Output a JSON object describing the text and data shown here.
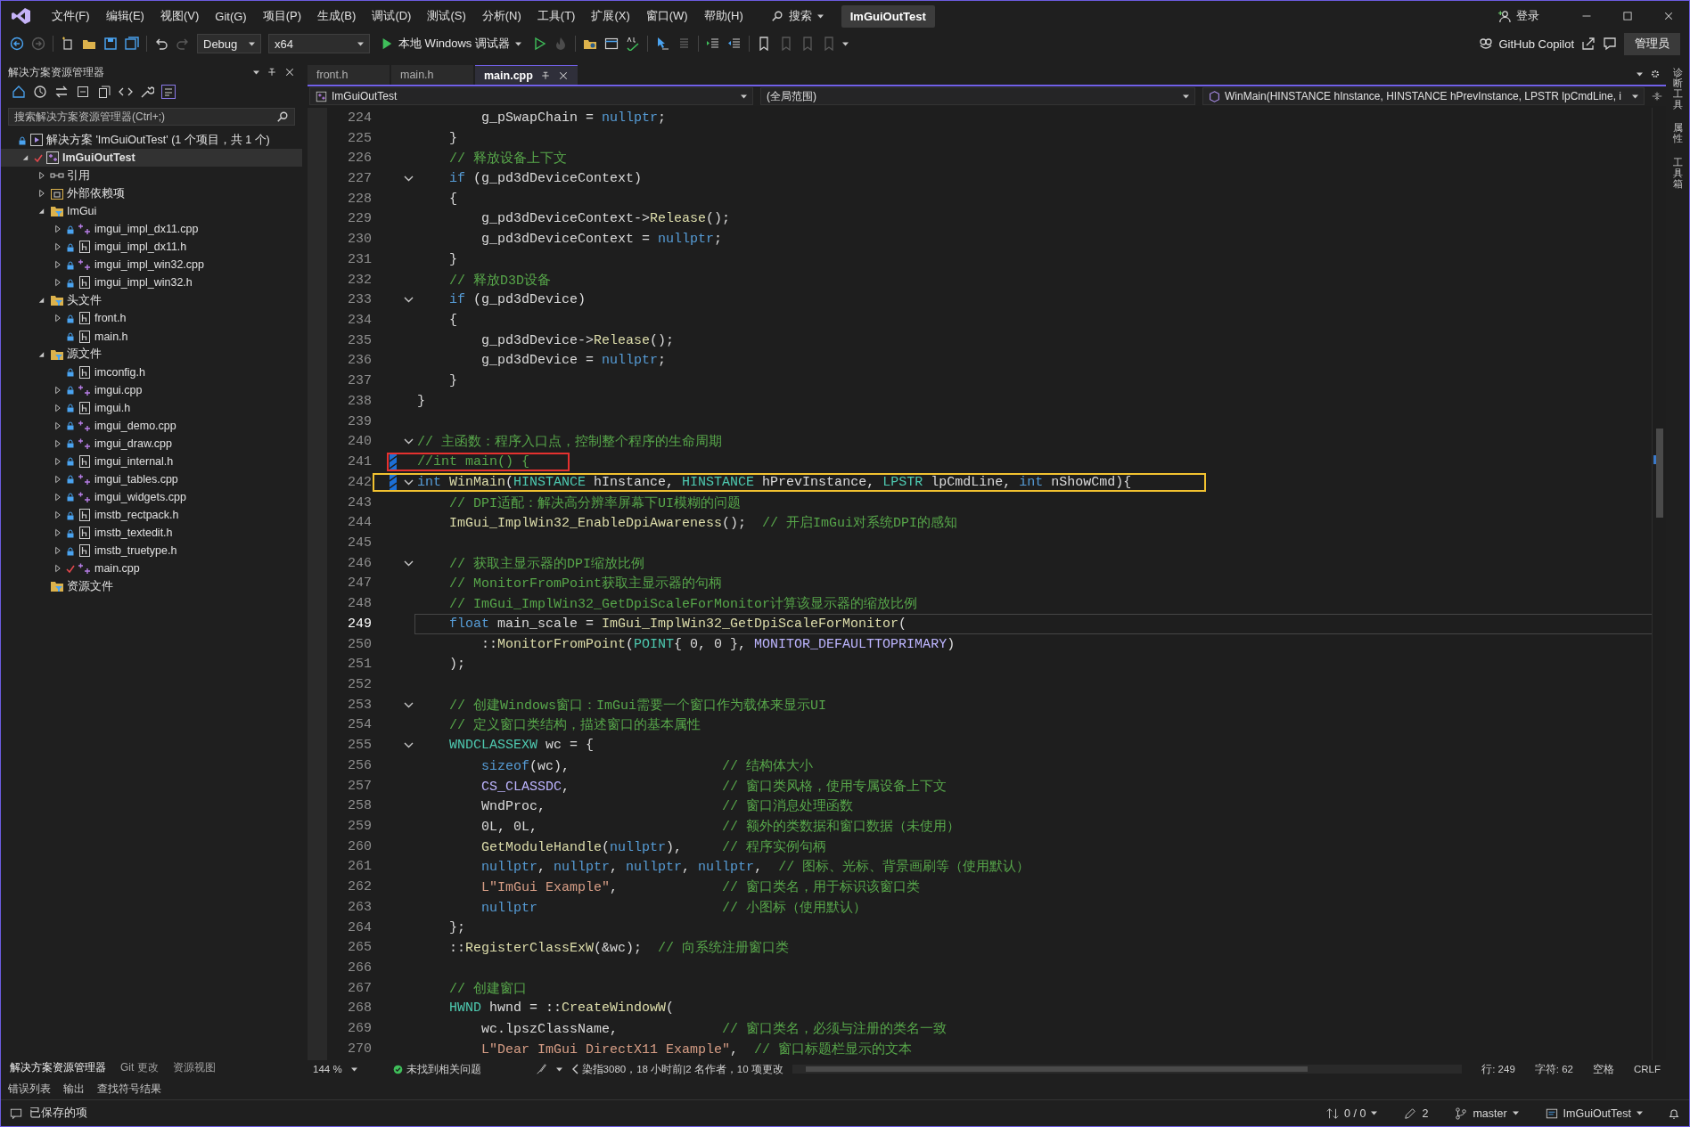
{
  "title_bar": {
    "menu": [
      "文件(F)",
      "编辑(E)",
      "视图(V)",
      "Git(G)",
      "项目(P)",
      "生成(B)",
      "调试(D)",
      "测试(S)",
      "分析(N)",
      "工具(T)",
      "扩展(X)",
      "窗口(W)",
      "帮助(H)"
    ],
    "search_label": "搜索",
    "solution_name": "ImGuiOutTest",
    "login_label": "登录"
  },
  "toolbar": {
    "configuration": "Debug",
    "platform": "x64",
    "run_label": "本地 Windows 调试器",
    "copilot_label": "GitHub Copilot",
    "admin_label": "管理员"
  },
  "solution_explorer": {
    "title": "解决方案资源管理器",
    "search": {
      "placeholder": "搜索解决方案资源管理器(Ctrl+;)"
    },
    "tree": [
      {
        "label": "解决方案 'ImGuiOutTest' (1 个项目，共 1 个)",
        "kind": "solution",
        "expandable": false,
        "locked": true,
        "edited": false,
        "selected": false,
        "children": [
          {
            "label": "ImGuiOutTest",
            "kind": "project",
            "expandable": true,
            "expanded": true,
            "locked": false,
            "edited": true,
            "selected": true,
            "children": [
              {
                "label": "引用",
                "kind": "references",
                "expandable": true,
                "expanded": false,
                "locked": false,
                "edited": false,
                "selected": false
              },
              {
                "label": "外部依赖项",
                "kind": "external",
                "expandable": true,
                "expanded": false,
                "locked": false,
                "edited": false,
                "selected": false
              },
              {
                "label": "ImGui",
                "kind": "filter",
                "expandable": true,
                "expanded": true,
                "locked": false,
                "edited": false,
                "selected": false,
                "children": [
                  {
                    "label": "imgui_impl_dx11.cpp",
                    "kind": "cpp",
                    "expandable": true,
                    "expanded": false,
                    "locked": true,
                    "edited": false,
                    "selected": false
                  },
                  {
                    "label": "imgui_impl_dx11.h",
                    "kind": "header",
                    "expandable": true,
                    "expanded": false,
                    "locked": true,
                    "edited": false,
                    "selected": false
                  },
                  {
                    "label": "imgui_impl_win32.cpp",
                    "kind": "cpp",
                    "expandable": true,
                    "expanded": false,
                    "locked": true,
                    "edited": false,
                    "selected": false
                  },
                  {
                    "label": "imgui_impl_win32.h",
                    "kind": "header",
                    "expandable": true,
                    "expanded": false,
                    "locked": true,
                    "edited": false,
                    "selected": false
                  }
                ]
              },
              {
                "label": "头文件",
                "kind": "filter",
                "expandable": true,
                "expanded": true,
                "locked": false,
                "edited": false,
                "selected": false,
                "children": [
                  {
                    "label": "front.h",
                    "kind": "header",
                    "expandable": true,
                    "expanded": false,
                    "locked": true,
                    "edited": false,
                    "selected": false
                  },
                  {
                    "label": "main.h",
                    "kind": "header",
                    "expandable": false,
                    "locked": true,
                    "edited": false,
                    "selected": false
                  }
                ]
              },
              {
                "label": "源文件",
                "kind": "filter",
                "expandable": true,
                "expanded": true,
                "locked": false,
                "edited": false,
                "selected": false,
                "children": [
                  {
                    "label": "imconfig.h",
                    "kind": "header",
                    "expandable": false,
                    "locked": true,
                    "edited": false,
                    "selected": false
                  },
                  {
                    "label": "imgui.cpp",
                    "kind": "cpp",
                    "expandable": true,
                    "expanded": false,
                    "locked": true,
                    "edited": false,
                    "selected": false
                  },
                  {
                    "label": "imgui.h",
                    "kind": "header",
                    "expandable": true,
                    "expanded": false,
                    "locked": true,
                    "edited": false,
                    "selected": false
                  },
                  {
                    "label": "imgui_demo.cpp",
                    "kind": "cpp",
                    "expandable": true,
                    "expanded": false,
                    "locked": true,
                    "edited": false,
                    "selected": false
                  },
                  {
                    "label": "imgui_draw.cpp",
                    "kind": "cpp",
                    "expandable": true,
                    "expanded": false,
                    "locked": true,
                    "edited": false,
                    "selected": false
                  },
                  {
                    "label": "imgui_internal.h",
                    "kind": "header",
                    "expandable": true,
                    "expanded": false,
                    "locked": true,
                    "edited": false,
                    "selected": false
                  },
                  {
                    "label": "imgui_tables.cpp",
                    "kind": "cpp",
                    "expandable": true,
                    "expanded": false,
                    "locked": true,
                    "edited": false,
                    "selected": false
                  },
                  {
                    "label": "imgui_widgets.cpp",
                    "kind": "cpp",
                    "expandable": true,
                    "expanded": false,
                    "locked": true,
                    "edited": false,
                    "selected": false
                  },
                  {
                    "label": "imstb_rectpack.h",
                    "kind": "header",
                    "expandable": true,
                    "expanded": false,
                    "locked": true,
                    "edited": false,
                    "selected": false
                  },
                  {
                    "label": "imstb_textedit.h",
                    "kind": "header",
                    "expandable": true,
                    "expanded": false,
                    "locked": true,
                    "edited": false,
                    "selected": false
                  },
                  {
                    "label": "imstb_truetype.h",
                    "kind": "header",
                    "expandable": true,
                    "expanded": false,
                    "locked": true,
                    "edited": false,
                    "selected": false
                  },
                  {
                    "label": "main.cpp",
                    "kind": "cpp",
                    "expandable": true,
                    "expanded": false,
                    "locked": false,
                    "edited": true,
                    "selected": false
                  }
                ]
              },
              {
                "label": "资源文件",
                "kind": "filter",
                "expandable": false,
                "locked": false,
                "edited": false,
                "selected": false
              }
            ]
          }
        ]
      }
    ],
    "tabs": [
      {
        "label": "解决方案资源管理器",
        "selected": true
      },
      {
        "label": "Git 更改",
        "selected": false
      },
      {
        "label": "资源视图",
        "selected": false
      }
    ]
  },
  "editor": {
    "tabs": [
      {
        "label": "front.h",
        "selected": false
      },
      {
        "label": "main.h",
        "selected": false
      },
      {
        "label": "main.cpp",
        "selected": true
      }
    ],
    "navigation": {
      "project": "ImGuiOutTest",
      "scope": "(全局范围)",
      "member": "WinMain(HINSTANCE hInstance, HINSTANCE hPrevInstance, LPSTR lpCmdLine, i"
    },
    "lines": [
      {
        "number": "224",
        "foldable": false,
        "changed": false,
        "current": false,
        "code": [
          {
            "kind": "plain",
            "text": "        g_pSwapChain = "
          },
          {
            "kind": "keyword",
            "text": "nullptr"
          },
          {
            "kind": "plain",
            "text": ";"
          }
        ]
      },
      {
        "number": "225",
        "foldable": false,
        "changed": false,
        "current": false,
        "code": [
          {
            "kind": "plain",
            "text": "    }"
          }
        ]
      },
      {
        "number": "226",
        "foldable": false,
        "changed": false,
        "current": false,
        "code": [
          {
            "kind": "comment",
            "text": "    // 释放设备上下文"
          }
        ]
      },
      {
        "number": "227",
        "foldable": true,
        "changed": false,
        "current": false,
        "code": [
          {
            "kind": "keyword",
            "text": "    if"
          },
          {
            "kind": "plain",
            "text": " (g_pd3dDeviceContext)"
          }
        ]
      },
      {
        "number": "228",
        "foldable": false,
        "changed": false,
        "current": false,
        "code": [
          {
            "kind": "plain",
            "text": "    {"
          }
        ]
      },
      {
        "number": "229",
        "foldable": false,
        "changed": false,
        "current": false,
        "code": [
          {
            "kind": "plain",
            "text": "        g_pd3dDeviceContext->"
          },
          {
            "kind": "function",
            "text": "Release"
          },
          {
            "kind": "plain",
            "text": "();"
          }
        ]
      },
      {
        "number": "230",
        "foldable": false,
        "changed": false,
        "current": false,
        "code": [
          {
            "kind": "plain",
            "text": "        g_pd3dDeviceContext = "
          },
          {
            "kind": "keyword",
            "text": "nullptr"
          },
          {
            "kind": "plain",
            "text": ";"
          }
        ]
      },
      {
        "number": "231",
        "foldable": false,
        "changed": false,
        "current": false,
        "code": [
          {
            "kind": "plain",
            "text": "    }"
          }
        ]
      },
      {
        "number": "232",
        "foldable": false,
        "changed": false,
        "current": false,
        "code": [
          {
            "kind": "comment",
            "text": "    // 释放D3D设备"
          }
        ]
      },
      {
        "number": "233",
        "foldable": true,
        "changed": false,
        "current": false,
        "code": [
          {
            "kind": "keyword",
            "text": "    if"
          },
          {
            "kind": "plain",
            "text": " (g_pd3dDevice)"
          }
        ]
      },
      {
        "number": "234",
        "foldable": false,
        "changed": false,
        "current": false,
        "code": [
          {
            "kind": "plain",
            "text": "    {"
          }
        ]
      },
      {
        "number": "235",
        "foldable": false,
        "changed": false,
        "current": false,
        "code": [
          {
            "kind": "plain",
            "text": "        g_pd3dDevice->"
          },
          {
            "kind": "function",
            "text": "Release"
          },
          {
            "kind": "plain",
            "text": "();"
          }
        ]
      },
      {
        "number": "236",
        "foldable": false,
        "changed": false,
        "current": false,
        "code": [
          {
            "kind": "plain",
            "text": "        g_pd3dDevice = "
          },
          {
            "kind": "keyword",
            "text": "nullptr"
          },
          {
            "kind": "plain",
            "text": ";"
          }
        ]
      },
      {
        "number": "237",
        "foldable": false,
        "changed": false,
        "current": false,
        "code": [
          {
            "kind": "plain",
            "text": "    }"
          }
        ]
      },
      {
        "number": "238",
        "foldable": false,
        "changed": false,
        "current": false,
        "code": [
          {
            "kind": "plain",
            "text": "}"
          }
        ]
      },
      {
        "number": "239",
        "foldable": false,
        "changed": false,
        "current": false
      },
      {
        "number": "240",
        "foldable": true,
        "changed": false,
        "current": false,
        "code": [
          {
            "kind": "comment",
            "text": "// 主函数：程序入口点，控制整个程序的生命周期"
          }
        ]
      },
      {
        "number": "241",
        "foldable": false,
        "changed": true,
        "current": false,
        "color": "#e5312f",
        "code": [
          {
            "kind": "comment",
            "text": "//int main() {"
          }
        ]
      },
      {
        "number": "242",
        "foldable": true,
        "changed": true,
        "current": false,
        "color": "#f2c230",
        "code": [
          {
            "kind": "keyword",
            "text": "int"
          },
          {
            "kind": "function",
            "text": " WinMain"
          },
          {
            "kind": "plain",
            "text": "("
          },
          {
            "kind": "type",
            "text": "HINSTANCE"
          },
          {
            "kind": "plain",
            "text": " hInstance, "
          },
          {
            "kind": "type",
            "text": "HINSTANCE"
          },
          {
            "kind": "plain",
            "text": " hPrevInstance, "
          },
          {
            "kind": "type",
            "text": "LPSTR"
          },
          {
            "kind": "plain",
            "text": " lpCmdLine, "
          },
          {
            "kind": "keyword",
            "text": "int"
          },
          {
            "kind": "plain",
            "text": " nShowCmd){"
          }
        ]
      },
      {
        "number": "243",
        "foldable": false,
        "changed": false,
        "current": false,
        "code": [
          {
            "kind": "comment",
            "text": "    // DPI适配：解决高分辨率屏幕下UI模糊的问题"
          }
        ]
      },
      {
        "number": "244",
        "foldable": false,
        "changed": false,
        "current": false,
        "code": [
          {
            "kind": "function",
            "text": "    ImGui_ImplWin32_EnableDpiAwareness"
          },
          {
            "kind": "plain",
            "text": "();  "
          },
          {
            "kind": "comment",
            "text": "// 开启ImGui对系统DPI的感知"
          }
        ]
      },
      {
        "number": "245",
        "foldable": false,
        "changed": false,
        "current": false
      },
      {
        "number": "246",
        "foldable": true,
        "changed": false,
        "current": false,
        "code": [
          {
            "kind": "comment",
            "text": "    // 获取主显示器的DPI缩放比例"
          }
        ]
      },
      {
        "number": "247",
        "foldable": false,
        "changed": false,
        "current": false,
        "code": [
          {
            "kind": "comment",
            "text": "    // MonitorFromPoint获取主显示器的句柄"
          }
        ]
      },
      {
        "number": "248",
        "foldable": false,
        "changed": false,
        "current": false,
        "code": [
          {
            "kind": "comment",
            "text": "    // ImGui_ImplWin32_GetDpiScaleForMonitor计算该显示器的缩放比例"
          }
        ]
      },
      {
        "number": "249",
        "foldable": false,
        "changed": false,
        "current": true,
        "code": [
          {
            "kind": "keyword",
            "text": "    float"
          },
          {
            "kind": "plain",
            "text": " main_scale = "
          },
          {
            "kind": "function",
            "text": "ImGui_ImplWin32_GetDpiScaleForMonitor"
          },
          {
            "kind": "plain",
            "text": "("
          }
        ]
      },
      {
        "number": "250",
        "foldable": false,
        "changed": false,
        "current": false,
        "code": [
          {
            "kind": "plain",
            "text": "        ::"
          },
          {
            "kind": "function",
            "text": "MonitorFromPoint"
          },
          {
            "kind": "plain",
            "text": "("
          },
          {
            "kind": "type",
            "text": "POINT"
          },
          {
            "kind": "plain",
            "text": "{ 0, 0 }, "
          },
          {
            "kind": "macro",
            "text": "MONITOR_DEFAULTTOPRIMARY"
          },
          {
            "kind": "plain",
            "text": ")"
          }
        ]
      },
      {
        "number": "251",
        "foldable": false,
        "changed": false,
        "current": false,
        "code": [
          {
            "kind": "plain",
            "text": "    );"
          }
        ]
      },
      {
        "number": "252",
        "foldable": false,
        "changed": false,
        "current": false
      },
      {
        "number": "253",
        "foldable": true,
        "changed": false,
        "current": false,
        "code": [
          {
            "kind": "comment",
            "text": "    // 创建Windows窗口：ImGui需要一个窗口作为载体来显示UI"
          }
        ]
      },
      {
        "number": "254",
        "foldable": false,
        "changed": false,
        "current": false,
        "code": [
          {
            "kind": "comment",
            "text": "    // 定义窗口类结构，描述窗口的基本属性"
          }
        ]
      },
      {
        "number": "255",
        "foldable": true,
        "changed": false,
        "current": false,
        "code": [
          {
            "kind": "type",
            "text": "    WNDCLASSEXW"
          },
          {
            "kind": "plain",
            "text": " wc = {"
          }
        ]
      },
      {
        "number": "256",
        "foldable": false,
        "changed": false,
        "current": false,
        "code": [
          {
            "kind": "keyword",
            "text": "        sizeof"
          },
          {
            "kind": "plain",
            "text": "(wc),                   "
          },
          {
            "kind": "comment",
            "text": "// 结构体大小"
          }
        ]
      },
      {
        "number": "257",
        "foldable": false,
        "changed": false,
        "current": false,
        "code": [
          {
            "kind": "macro",
            "text": "        CS_CLASSDC"
          },
          {
            "kind": "plain",
            "text": ",                   "
          },
          {
            "kind": "comment",
            "text": "// 窗口类风格，使用专属设备上下文"
          }
        ]
      },
      {
        "number": "258",
        "foldable": false,
        "changed": false,
        "current": false,
        "code": [
          {
            "kind": "plain",
            "text": "        WndProc,                      "
          },
          {
            "kind": "comment",
            "text": "// 窗口消息处理函数"
          }
        ]
      },
      {
        "number": "259",
        "foldable": false,
        "changed": false,
        "current": false,
        "code": [
          {
            "kind": "plain",
            "text": "        0L, 0L,                       "
          },
          {
            "kind": "comment",
            "text": "// 额外的类数据和窗口数据（未使用）"
          }
        ]
      },
      {
        "number": "260",
        "foldable": false,
        "changed": false,
        "current": false,
        "code": [
          {
            "kind": "function",
            "text": "        GetModuleHandle"
          },
          {
            "kind": "plain",
            "text": "("
          },
          {
            "kind": "keyword",
            "text": "nullptr"
          },
          {
            "kind": "plain",
            "text": "),     "
          },
          {
            "kind": "comment",
            "text": "// 程序实例句柄"
          }
        ]
      },
      {
        "number": "261",
        "foldable": false,
        "changed": false,
        "current": false,
        "code": [
          {
            "kind": "keyword",
            "text": "        nullptr"
          },
          {
            "kind": "plain",
            "text": ", "
          },
          {
            "kind": "keyword",
            "text": "nullptr"
          },
          {
            "kind": "plain",
            "text": ", "
          },
          {
            "kind": "keyword",
            "text": "nullptr"
          },
          {
            "kind": "plain",
            "text": ", "
          },
          {
            "kind": "keyword",
            "text": "nullptr"
          },
          {
            "kind": "plain",
            "text": ",  "
          },
          {
            "kind": "comment",
            "text": "// 图标、光标、背景画刷等（使用默认）"
          }
        ]
      },
      {
        "number": "262",
        "foldable": false,
        "changed": false,
        "current": false,
        "code": [
          {
            "kind": "string",
            "text": "        L\"ImGui Example\""
          },
          {
            "kind": "plain",
            "text": ",             "
          },
          {
            "kind": "comment",
            "text": "// 窗口类名，用于标识该窗口类"
          }
        ]
      },
      {
        "number": "263",
        "foldable": false,
        "changed": false,
        "current": false,
        "code": [
          {
            "kind": "keyword",
            "text": "        nullptr"
          },
          {
            "kind": "comment",
            "text": "                       // 小图标（使用默认）"
          }
        ]
      },
      {
        "number": "264",
        "foldable": false,
        "changed": false,
        "current": false,
        "code": [
          {
            "kind": "plain",
            "text": "    };"
          }
        ]
      },
      {
        "number": "265",
        "foldable": false,
        "changed": false,
        "current": false,
        "code": [
          {
            "kind": "plain",
            "text": "    ::"
          },
          {
            "kind": "function",
            "text": "RegisterClassExW"
          },
          {
            "kind": "plain",
            "text": "(&wc);  "
          },
          {
            "kind": "comment",
            "text": "// 向系统注册窗口类"
          }
        ]
      },
      {
        "number": "266",
        "foldable": false,
        "changed": false,
        "current": false
      },
      {
        "number": "267",
        "foldable": false,
        "changed": false,
        "current": false,
        "code": [
          {
            "kind": "comment",
            "text": "    // 创建窗口"
          }
        ]
      },
      {
        "number": "268",
        "foldable": false,
        "changed": false,
        "current": false,
        "code": [
          {
            "kind": "type",
            "text": "    HWND"
          },
          {
            "kind": "plain",
            "text": " hwnd = ::"
          },
          {
            "kind": "function",
            "text": "CreateWindowW"
          },
          {
            "kind": "plain",
            "text": "("
          }
        ]
      },
      {
        "number": "269",
        "foldable": false,
        "changed": false,
        "current": false,
        "code": [
          {
            "kind": "plain",
            "text": "        wc.lpszClassName,             "
          },
          {
            "kind": "comment",
            "text": "// 窗口类名，必须与注册的类名一致"
          }
        ]
      },
      {
        "number": "270",
        "foldable": false,
        "changed": false,
        "current": false,
        "code": [
          {
            "kind": "string",
            "text": "        L\"Dear ImGui DirectX11 Example\""
          },
          {
            "kind": "plain",
            "text": ",  "
          },
          {
            "kind": "comment",
            "text": "// 窗口标题栏显示的文本"
          }
        ]
      }
    ],
    "info_bar": {
      "zoom": "144 %",
      "issues": "未找到相关问题",
      "blame": "染指3080，18 小时前|2 名作者，10 项更改",
      "line": "行: 249",
      "column": "字符: 62",
      "whitespace": "空格",
      "line_ending": "CRLF"
    }
  },
  "tool_strip": [
    "诊断工具",
    "属性",
    "工具箱"
  ],
  "panel_tabs": [
    "错误列表",
    "输出",
    "查找符号结果"
  ],
  "status_bar": {
    "message": "已保存的项",
    "changes": "0 / 0",
    "edits": "2",
    "branch": "master",
    "repository": "ImGuiOutTest"
  }
}
